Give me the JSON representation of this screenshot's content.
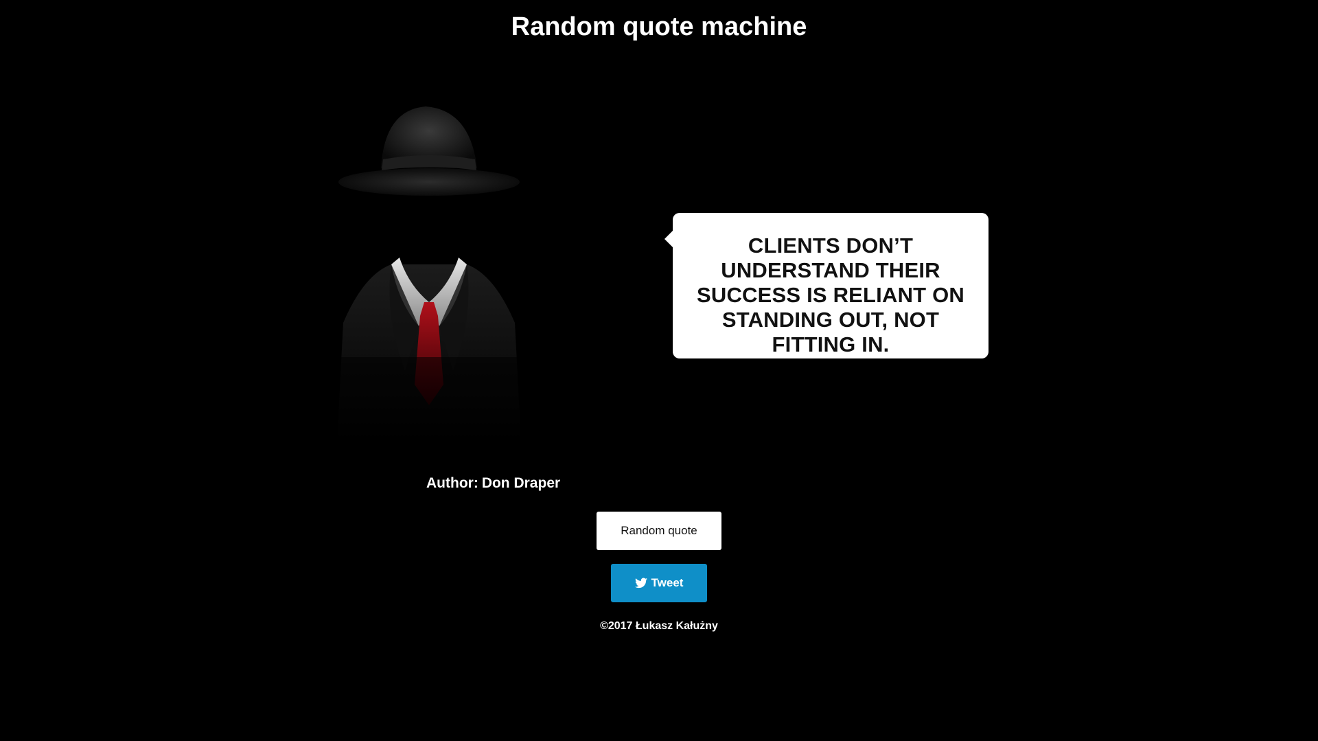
{
  "header": {
    "title": "Random quote machine"
  },
  "figure": {
    "icon": "faceless-man-in-fedora-illustration"
  },
  "quote": {
    "text": "CLIENTS DON’T UNDERSTAND THEIR SUCCESS IS RELIANT ON STANDING OUT, NOT FITTING IN."
  },
  "author": {
    "label": "Author:",
    "name": "Don Draper"
  },
  "buttons": {
    "random_label": "Random quote",
    "tweet_label": "Tweet",
    "tweet_icon": "twitter-bird-icon",
    "tweet_color": "#0f8fc8"
  },
  "footer": {
    "text": "©2017 Łukasz Kałużny"
  }
}
